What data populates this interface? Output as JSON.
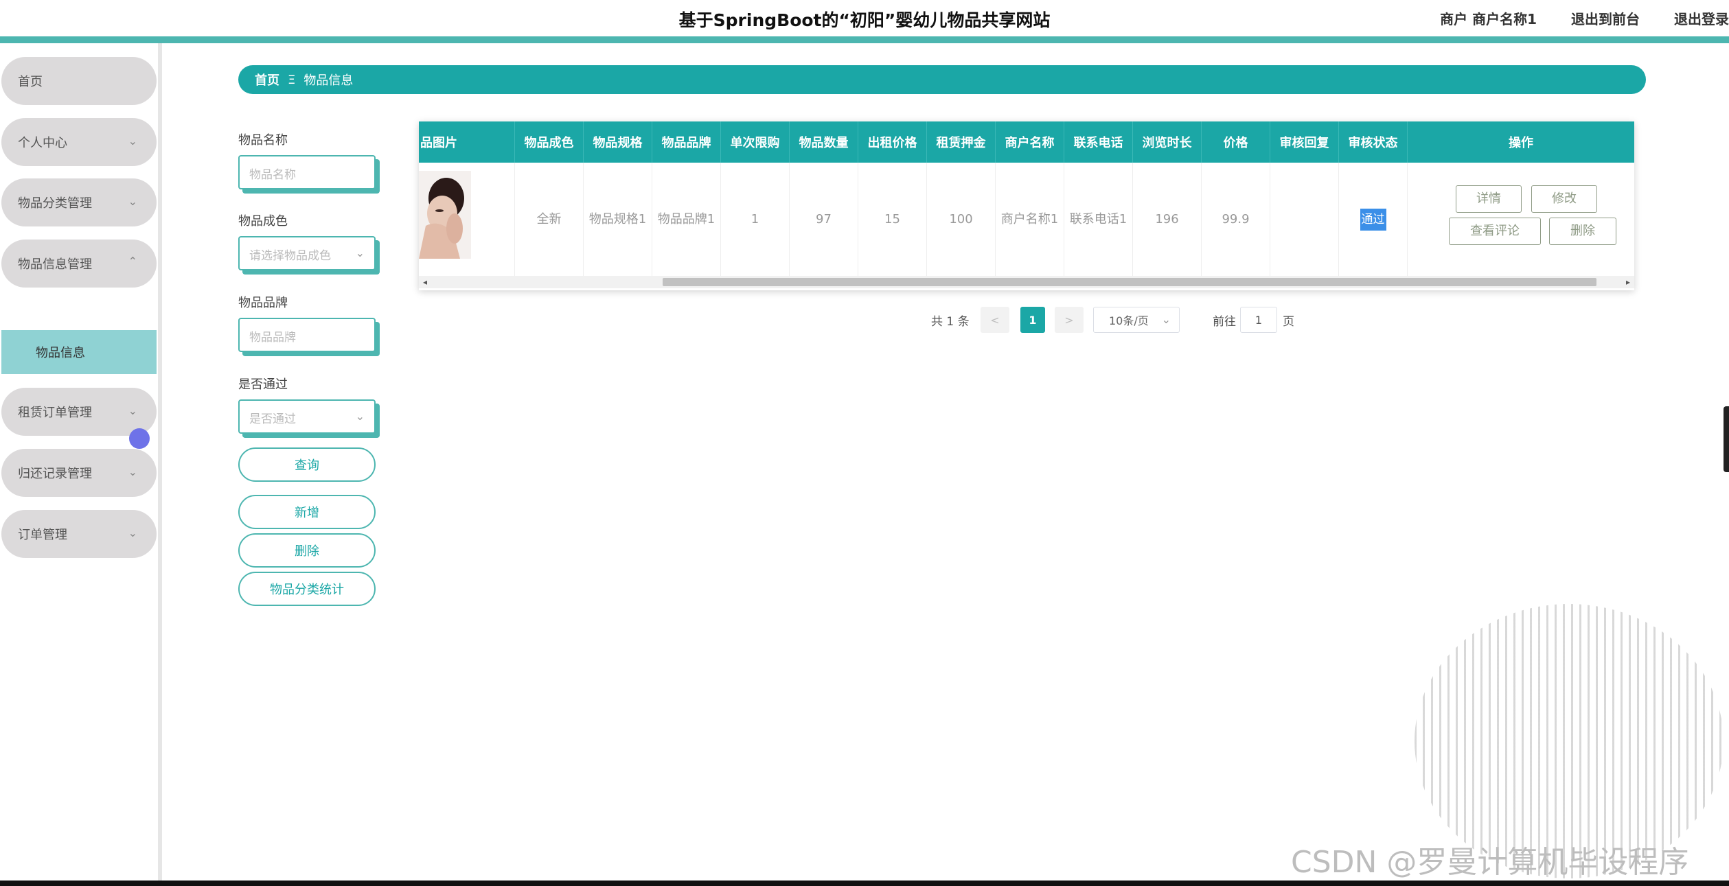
{
  "header": {
    "title": "基于SpringBoot的“初阳”婴幼儿物品共享网站",
    "user_label": "商户 商户名称1",
    "link_front": "退出到前台",
    "link_logout": "退出登录"
  },
  "sidebar": {
    "items": [
      {
        "label": "首页"
      },
      {
        "label": "个人中心"
      },
      {
        "label": "物品分类管理"
      },
      {
        "label": "物品信息管理"
      },
      {
        "label": "租赁订单管理"
      },
      {
        "label": "归还记录管理"
      },
      {
        "label": "订单管理"
      }
    ],
    "active_sub": "物品信息"
  },
  "breadcrumb": {
    "home": "首页",
    "separator": "Ξ",
    "current": "物品信息"
  },
  "filters": {
    "name_label": "物品名称",
    "name_placeholder": "物品名称",
    "condition_label": "物品成色",
    "condition_placeholder": "请选择物品成色",
    "brand_label": "物品品牌",
    "brand_placeholder": "物品品牌",
    "pass_label": "是否通过",
    "pass_placeholder": "是否通过"
  },
  "buttons": {
    "query": "查询",
    "add": "新增",
    "delete": "删除",
    "stats": "物品分类统计"
  },
  "table": {
    "columns": [
      "品图片",
      "物品成色",
      "物品规格",
      "物品品牌",
      "单次限购",
      "物品数量",
      "出租价格",
      "租赁押金",
      "商户名称",
      "联系电话",
      "浏览时长",
      "价格",
      "审核回复",
      "审核状态",
      "操作"
    ],
    "row": {
      "condition": "全新",
      "spec": "物品规格1",
      "brand": "物品品牌1",
      "limit": "1",
      "quantity": "97",
      "rent_price": "15",
      "deposit": "100",
      "merchant": "商户名称1",
      "phone": "联系电话1",
      "browse": "196",
      "price": "99.9",
      "reply": "",
      "status": "通过"
    },
    "ops": {
      "detail": "详情",
      "edit": "修改",
      "comments": "查看评论",
      "delete": "删除"
    }
  },
  "pagination": {
    "total": "共 1 条",
    "prev": "<",
    "current": "1",
    "next": ">",
    "page_size": "10条/页",
    "goto_label": "前往",
    "goto_value": "1",
    "goto_suffix": "页"
  },
  "watermark": "CSDN @罗曼计算机毕设程序"
}
